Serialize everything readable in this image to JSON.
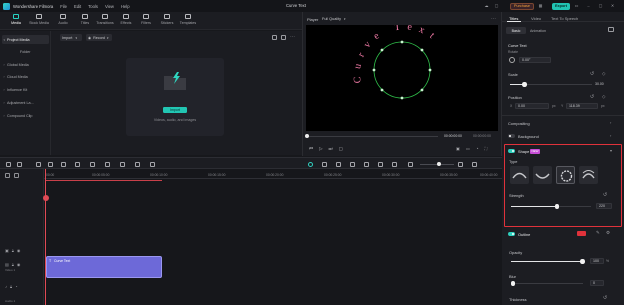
{
  "app": {
    "name": "Wondershare Filmora",
    "project_title": "Curve Text",
    "purchase_label": "Purchase",
    "export_label": "Export"
  },
  "menu": [
    "File",
    "Edit",
    "Tools",
    "View",
    "Help"
  ],
  "toolbar": [
    {
      "label": "Media",
      "icon": "media-icon"
    },
    {
      "label": "Stock Media",
      "icon": "stock-media-icon"
    },
    {
      "label": "Audio",
      "icon": "audio-icon"
    },
    {
      "label": "Titles",
      "icon": "titles-icon"
    },
    {
      "label": "Transitions",
      "icon": "transitions-icon"
    },
    {
      "label": "Effects",
      "icon": "effects-icon"
    },
    {
      "label": "Filters",
      "icon": "filters-icon"
    },
    {
      "label": "Stickers",
      "icon": "stickers-icon"
    },
    {
      "label": "Templates",
      "icon": "templates-icon"
    }
  ],
  "sidebar": {
    "items": [
      {
        "label": "Project Media",
        "active": true
      },
      {
        "label": "Folder",
        "active": false
      },
      {
        "label": "Global Media",
        "active": false
      },
      {
        "label": "Cloud Media",
        "active": false
      },
      {
        "label": "Influence Kit",
        "active": false
      },
      {
        "label": "Adjustment La...",
        "active": false
      },
      {
        "label": "Compound Clip",
        "active": false
      }
    ]
  },
  "media": {
    "import_dropdown": "Import",
    "record_dropdown": "Record",
    "import_button": "Import",
    "hint": "Videos, audio, and images"
  },
  "player": {
    "label": "Player",
    "quality": "Full Quality",
    "curve_text": "Curve Text",
    "time_current": "00:00:00:00",
    "time_total": "00:00:00:00"
  },
  "props": {
    "tabs": [
      "Titles",
      "Video",
      "Text To Speech"
    ],
    "subtabs": [
      "Basic",
      "Animation"
    ],
    "section_title": "Curve Text",
    "rotate_label": "Rotate",
    "rotate_value": "0.00°",
    "scale_label": "Scale",
    "scale_value": "30.00",
    "position_label": "Position",
    "pos_x_label": "X",
    "pos_x_value": "0.00",
    "pos_x_unit": "px",
    "pos_y_label": "Y",
    "pos_y_value": "118.39",
    "pos_y_unit": "px",
    "compositing_label": "Compositing",
    "background_label": "Background",
    "shape_label": "Shape",
    "shape_badge": "NEW",
    "type_label": "Type",
    "strength_label": "Strength",
    "strength_value": "220",
    "outline_label": "Outline",
    "opacity_label": "Opacity",
    "opacity_value": "100",
    "opacity_unit": "%",
    "blur_label": "Blur",
    "blur_value": "0",
    "thickness_label": "Thickness",
    "highlight_color": "#e0323b",
    "accent_color": "#2fcfbd"
  },
  "timeline": {
    "ruler": [
      "00:00",
      "00:00:05:00",
      "00:00:10:00",
      "00:00:15:00",
      "00:00:20:00",
      "00:00:25:00",
      "00:00:30:00",
      "00:00:35:00",
      "00:00:40:00"
    ],
    "clip_label": "Curve Text",
    "track_video": "Video 1",
    "track_audio": "Audio 1"
  }
}
